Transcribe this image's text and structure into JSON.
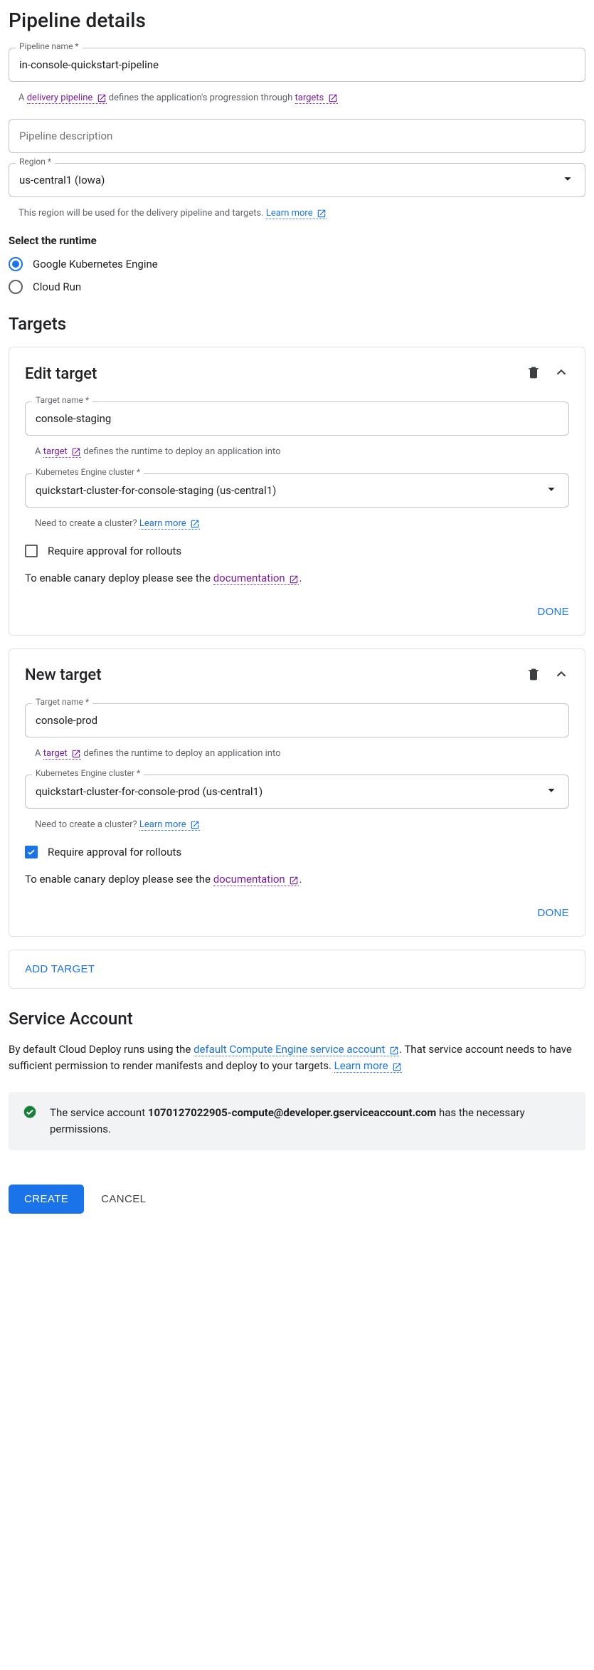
{
  "headings": {
    "pipeline_details": "Pipeline details",
    "targets": "Targets",
    "service_account": "Service Account"
  },
  "pipeline": {
    "name_label": "Pipeline name *",
    "name_value": "in-console-quickstart-pipeline",
    "helper_pre": "A ",
    "helper_link": "delivery pipeline",
    "helper_mid": " defines the application's progression through ",
    "helper_link2": "targets",
    "description_placeholder": "Pipeline description",
    "region_label": "Region *",
    "region_value": "us-central1 (Iowa)",
    "region_helper": "This region will be used for the delivery pipeline and targets. ",
    "region_learn": "Learn more"
  },
  "runtime": {
    "heading": "Select the runtime",
    "options": [
      {
        "label": "Google Kubernetes Engine",
        "selected": true
      },
      {
        "label": "Cloud Run",
        "selected": false
      }
    ]
  },
  "targets": [
    {
      "card_title": "Edit target",
      "name_label": "Target name *",
      "name_value": "console-staging",
      "helper": {
        "pre": "A ",
        "link": "target",
        "post": " defines the runtime to deploy an application into"
      },
      "cluster_label": "Kubernetes Engine cluster *",
      "cluster_value": "quickstart-cluster-for-console-staging (us-central1)",
      "cluster_helper": "Need to create a cluster? ",
      "cluster_learn": "Learn more",
      "approval_label": "Require approval for rollouts",
      "approval_checked": false,
      "canary": {
        "pre": "To enable canary deploy please see the ",
        "link": "documentation",
        "post": "."
      },
      "done": "DONE"
    },
    {
      "card_title": "New target",
      "name_label": "Target name *",
      "name_value": "console-prod",
      "helper": {
        "pre": "A ",
        "link": "target",
        "post": " defines the runtime to deploy an application into"
      },
      "cluster_label": "Kubernetes Engine cluster *",
      "cluster_value": "quickstart-cluster-for-console-prod (us-central1)",
      "cluster_helper": "Need to create a cluster? ",
      "cluster_learn": "Learn more",
      "approval_label": "Require approval for rollouts",
      "approval_checked": true,
      "canary": {
        "pre": "To enable canary deploy please see the ",
        "link": "documentation",
        "post": "."
      },
      "done": "DONE"
    }
  ],
  "add_target": "ADD TARGET",
  "service_account": {
    "pre": "By default Cloud Deploy runs using the ",
    "link": "default Compute Engine service account",
    "post": ". That service account needs to have sufficient permission to render manifests and deploy to your targets. ",
    "learn": "Learn more",
    "notice_pre": "The service account ",
    "notice_email": "1070127022905-compute@developer.gserviceaccount.com",
    "notice_post": " has the necessary permissions."
  },
  "actions": {
    "create": "CREATE",
    "cancel": "CANCEL"
  }
}
